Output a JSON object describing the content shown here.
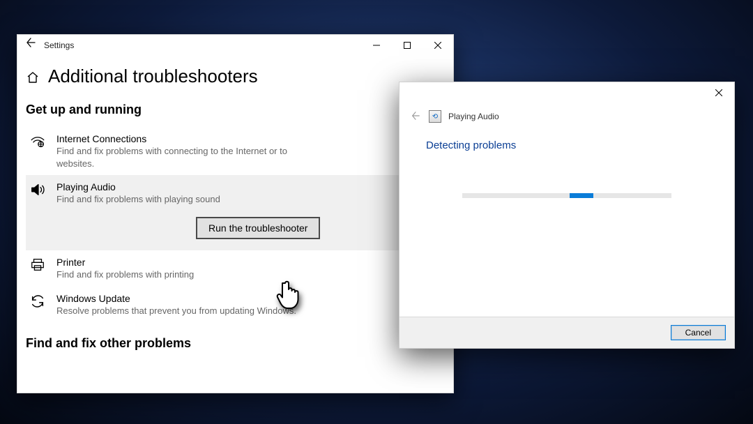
{
  "settings": {
    "window_title": "Settings",
    "page_title": "Additional troubleshooters",
    "section_get_up": "Get up and running",
    "section_find_fix": "Find and fix other problems",
    "run_button": "Run the troubleshooter",
    "items": [
      {
        "name": "Internet Connections",
        "desc": "Find and fix problems with connecting to the Internet or to websites."
      },
      {
        "name": "Playing Audio",
        "desc": "Find and fix problems with playing sound"
      },
      {
        "name": "Printer",
        "desc": "Find and fix problems with printing"
      },
      {
        "name": "Windows Update",
        "desc": "Resolve problems that prevent you from updating Windows."
      }
    ]
  },
  "dialog": {
    "title": "Playing Audio",
    "heading": "Detecting problems",
    "cancel": "Cancel"
  }
}
